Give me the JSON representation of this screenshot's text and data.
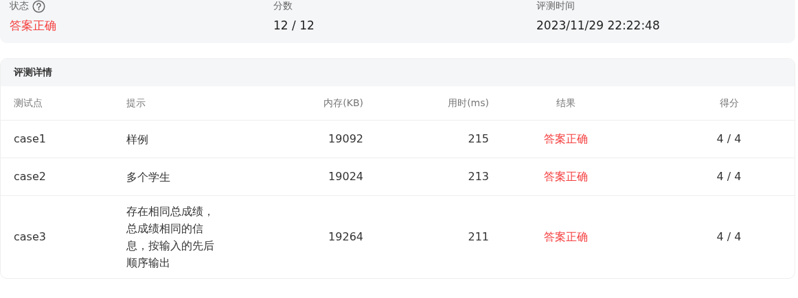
{
  "summary": [
    {
      "label": "状态",
      "help_icon": true,
      "value": "答案正确",
      "color": "#f53f3f"
    },
    {
      "label": "分数",
      "help_icon": false,
      "value": "12 / 12",
      "color": "#222222"
    },
    {
      "label": "评测时间",
      "help_icon": false,
      "value": "2023/11/29 22:22:48",
      "color": "#222222"
    }
  ],
  "details": {
    "title": "评测详情",
    "columns": [
      "测试点",
      "提示",
      "内存(KB)",
      "用时(ms)",
      "结果",
      "得分"
    ],
    "rows": [
      {
        "cells": [
          "case1",
          "样例",
          "19092",
          "215",
          "答案正确",
          "4 / 4"
        ],
        "color": "#f53f3f"
      },
      {
        "cells": [
          "case2",
          "多个学生",
          "19024",
          "213",
          "答案正确",
          "4 / 4"
        ],
        "color": "#f53f3f"
      },
      {
        "cells": [
          "case3",
          "存在相同总成绩，总成绩相同的信息，按输入的先后顺序输出",
          "19264",
          "211",
          "答案正确",
          "4 / 4"
        ],
        "color": "#f53f3f"
      }
    ]
  }
}
